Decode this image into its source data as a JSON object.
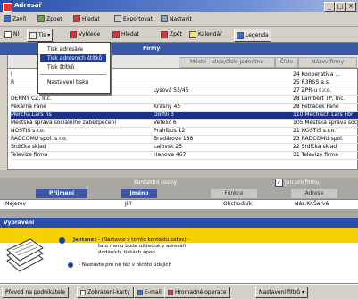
{
  "window": {
    "title": "Adresář"
  },
  "menubar": {
    "items": [
      {
        "label": "Zavři",
        "icon": "close-icon"
      },
      {
        "label": "Zpoet",
        "icon": "back-icon"
      },
      {
        "label": "Hledat",
        "icon": "mail-icon"
      },
      {
        "label": "Exportovat",
        "icon": "export-icon"
      },
      {
        "label": "Nastavit",
        "icon": "settings-icon"
      }
    ]
  },
  "toolbar": {
    "items": [
      {
        "label": "Nl",
        "icon": "list-icon"
      },
      {
        "label": "Tis",
        "icon": "print-icon"
      },
      {
        "label": "Vyhlede",
        "icon": "search-icon"
      },
      {
        "label": "Hledat",
        "icon": "find-icon"
      },
      {
        "label": "Zpět",
        "icon": "undo-icon"
      },
      {
        "label": "Kalendář",
        "icon": "calendar-icon"
      },
      {
        "label": "Legenda",
        "icon": "legend-icon"
      }
    ]
  },
  "dropdown": {
    "items": [
      "Tisk adresáře",
      "Tisk adresních štítků",
      "Tisk štítků",
      "Nastavení tisku"
    ],
    "selected_index": 1
  },
  "grid": {
    "group_header": "Firmy",
    "col_headers": [
      "Město - ulice/číslo jednotné",
      "Číslo",
      "Název firmy"
    ],
    "rows": [
      {
        "a": "I",
        "b": "",
        "c": "24 Kooperativa ...",
        "sel": false
      },
      {
        "a": "R",
        "b": "",
        "c": "25 R3RSS a.s.",
        "sel": false
      },
      {
        "a": "",
        "b": "Lysová 55/45",
        "c": "27 ZPR-u s.r.o.",
        "sel": false
      },
      {
        "a": "DENNY CZ, Inc.",
        "b": "",
        "c": "28 Lambert TP, Inc.",
        "sel": false
      },
      {
        "a": "Pekárna Fané",
        "b": "Krásný 45",
        "c": "28 Petráček Fané",
        "sel": false
      },
      {
        "a": "Mercha.Lars Rs",
        "b": "Dolfili 3",
        "c": "110 Mechisch Lars Fbr",
        "sel": true
      },
      {
        "a": "Městská správa sociálního zabezpečení",
        "b": "Vetelič 6",
        "c": "105 Městská správa sociál",
        "sel": false
      },
      {
        "a": "NOSTIS s.r.o.",
        "b": "Prahlbus 12",
        "c": "21 NOSTIS s.r.o.",
        "sel": false
      },
      {
        "a": "RADCOMU spol. s r.o.",
        "b": "Bradárova 188",
        "c": "23 RADCOMU spol.",
        "sel": false
      },
      {
        "a": "Srdíčka sklad",
        "b": "Lalovsk 25",
        "c": "22 Srdíčka sklad",
        "sel": false
      },
      {
        "a": "Televize firma",
        "b": "Hanova 467",
        "c": "31 Televize firma",
        "sel": false
      }
    ]
  },
  "lower": {
    "title": "Kontaktní osoby",
    "checkbox_label": "Jen pro firmu",
    "tabs": [
      "Příjmení",
      "Jméno",
      "Funkce",
      "Adresa"
    ],
    "strip_values": [
      "Nejerov",
      "Jiří",
      "Obchodník",
      "Nás.Kr.Šarvá"
    ]
  },
  "help": {
    "bar_title": "Vyprávění",
    "heading": "Jantsné:",
    "line1": "- (Nastavte v tomto kontextu ústav) - ",
    "line2": "tato menu bude užitečné v adresáři",
    "line3": "dodáních, tiskách apod.",
    "bullet": "- Nastavte pro ně též v těchto údajích"
  },
  "bottombar": {
    "buttons": [
      {
        "label": "Převod na podnikatele",
        "icon": "transfer-icon"
      },
      {
        "label": "Zobrazení-karty",
        "icon": "card-icon"
      },
      {
        "label": "E-mail",
        "icon": "email-icon"
      },
      {
        "label": "Hromadné operace",
        "icon": "bulk-icon"
      },
      {
        "label": "Nastavení filtrů",
        "icon": "filter-icon"
      }
    ]
  }
}
